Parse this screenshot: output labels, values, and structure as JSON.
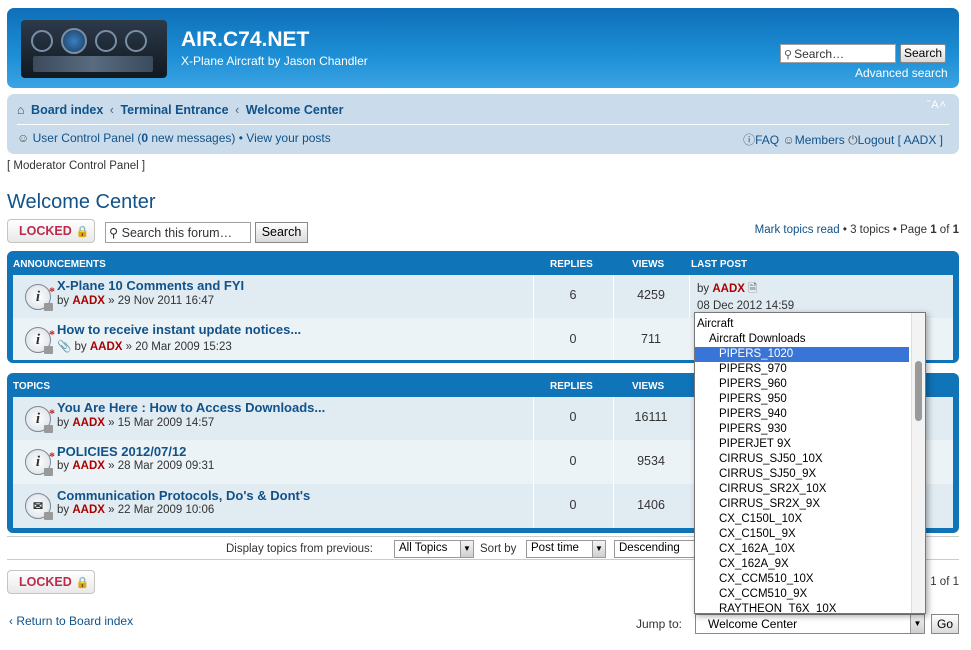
{
  "header": {
    "site_title": "AIR.C74.NET",
    "site_desc": "X-Plane Aircraft by Jason Chandler",
    "search_placeholder": "Search…",
    "search_button": "Search",
    "advanced_search": "Advanced search"
  },
  "navbar": {
    "crumbs": [
      "Board index",
      "Terminal Entrance",
      "Welcome Center"
    ],
    "crumb_sep": "‹",
    "font_size_toggle": "ˇA˄",
    "ucp_label": "User Control Panel (",
    "ucp_count": "0",
    "ucp_suffix": " new messages)",
    "bullet": "•",
    "view_posts": "View your posts",
    "faq": "FAQ",
    "members": "Members",
    "logout": "Logout [ AADX ]"
  },
  "mcp": "[ Moderator Control Panel ]",
  "page_title": "Welcome Center",
  "locked_label": "LOCKED",
  "forum_search": {
    "placeholder": "Search this forum…",
    "button": "Search"
  },
  "pagination_top": {
    "mark_read": "Mark topics read",
    "info": " • 3 topics • Page ",
    "page": "1",
    "of": " of ",
    "total": "1"
  },
  "announcements": {
    "headers": {
      "title": "ANNOUNCEMENTS",
      "replies": "REPLIES",
      "views": "VIEWS",
      "last_post": "LAST POST"
    },
    "rows": [
      {
        "title": "X-Plane 10 Comments and FYI",
        "by": "by ",
        "author": "AADX",
        "date": " » 29 Nov 2011 16:47",
        "replies": "6",
        "views": "4259",
        "last_by": "by ",
        "last_user": "AADX",
        "last_date": "08 Dec 2012 14:59"
      },
      {
        "title": "How to receive instant update notices...",
        "by": "by ",
        "author": "AADX",
        "date": " » 20 Mar 2009 15:23",
        "replies": "0",
        "views": "711"
      }
    ]
  },
  "topics": {
    "headers": {
      "title": "TOPICS",
      "replies": "REPLIES",
      "views": "VIEWS"
    },
    "rows": [
      {
        "title": "You Are Here : How to Access Downloads...",
        "by": "by ",
        "author": "AADX",
        "date": " » 15 Mar 2009 14:57",
        "replies": "0",
        "views": "16111"
      },
      {
        "title": "POLICIES 2012/07/12",
        "by": "by ",
        "author": "AADX",
        "date": " » 28 Mar 2009 09:31",
        "replies": "0",
        "views": "9534"
      },
      {
        "title": "Communication Protocols, Do's & Dont's",
        "by": "by ",
        "author": "AADX",
        "date": " » 22 Mar 2009 10:06",
        "replies": "0",
        "views": "1406"
      }
    ]
  },
  "sortbar": {
    "display_label": "Display topics from previous:",
    "display_value": "All Topics",
    "sort_label": "Sort by",
    "sort_value": "Post time",
    "order_value": "Descending"
  },
  "pagination_bottom": "1 of 1",
  "return_link": "Return to Board index",
  "jump_label": "Jump to:",
  "jump_value": "Welcome Center",
  "go_button": "Go",
  "dropdown": {
    "items": [
      {
        "label": "Aircraft",
        "indent": 0
      },
      {
        "label": "Aircraft Downloads",
        "indent": 1
      },
      {
        "label": "PIPERS_1020",
        "indent": 2,
        "selected": true
      },
      {
        "label": "PIPERS_970",
        "indent": 2
      },
      {
        "label": "PIPERS_960",
        "indent": 2
      },
      {
        "label": "PIPERS_950",
        "indent": 2
      },
      {
        "label": "PIPERS_940",
        "indent": 2
      },
      {
        "label": "PIPERS_930",
        "indent": 2
      },
      {
        "label": "PIPERJET 9X",
        "indent": 2
      },
      {
        "label": "CIRRUS_SJ50_10X",
        "indent": 2
      },
      {
        "label": "CIRRUS_SJ50_9X",
        "indent": 2
      },
      {
        "label": "CIRRUS_SR2X_10X",
        "indent": 2
      },
      {
        "label": "CIRRUS_SR2X_9X",
        "indent": 2
      },
      {
        "label": "CX_C150L_10X",
        "indent": 2
      },
      {
        "label": "CX_C150L_9X",
        "indent": 2
      },
      {
        "label": "CX_162A_10X",
        "indent": 2
      },
      {
        "label": "CX_162A_9X",
        "indent": 2
      },
      {
        "label": "CX_CCM510_10X",
        "indent": 2
      },
      {
        "label": "CX_CCM510_9X",
        "indent": 2
      },
      {
        "label": "RAYTHEON_T6X_10X",
        "indent": 2
      }
    ]
  }
}
